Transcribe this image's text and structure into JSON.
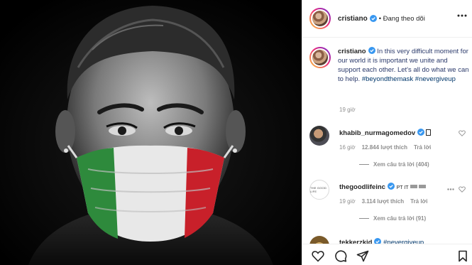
{
  "post": {
    "author": "cristiano",
    "follow_status": "• Đang theo dõi",
    "caption_text": " In this very difficult moment for our world it is important we unite and support each other. Let's all do what we can to help. ",
    "caption_tags": "#beyondthemask #nevergiveup",
    "time": "19 giờ"
  },
  "comments": [
    {
      "user": "khabib_nurmagomedov",
      "time": "16 giờ",
      "likes": "12.844 lượt thích",
      "reply_label": "Trả lời",
      "view_replies": "Xem câu trả lời (404)"
    },
    {
      "user": "thegoodlifeinc",
      "text": "PT IT",
      "logo_text": "THE GOOD LIFE",
      "time": "19 giờ",
      "likes": "3.114 lượt thích",
      "reply_label": "Trả lời",
      "view_replies": "Xem câu trả lời (91)"
    },
    {
      "user": "tekkerzkid",
      "text": "#nevergiveup"
    }
  ],
  "icons": {
    "verified": "verified-badge-icon",
    "more": "more-options-icon",
    "like": "heart-icon",
    "comment": "comment-icon",
    "share": "share-icon",
    "save": "bookmark-icon"
  },
  "colors": {
    "verified_blue": "#3897f0",
    "hashtag": "#00376b",
    "muted": "#8e8e8e",
    "mask_green": "#2e8a3c",
    "mask_red": "#c8202a"
  }
}
